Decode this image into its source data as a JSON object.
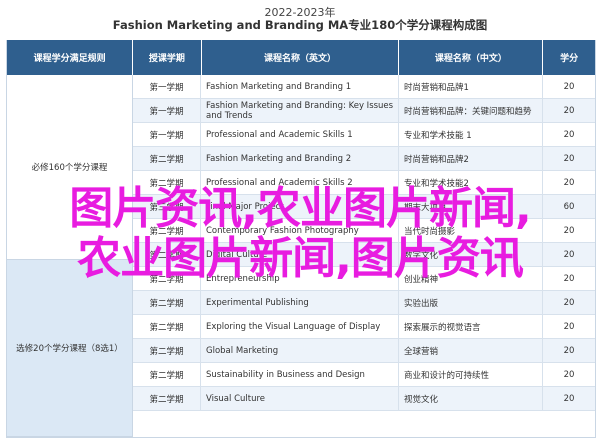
{
  "header": {
    "year": "2022-2023年",
    "title": "Fashion Marketing and Branding MA专业180个学分课程构成图"
  },
  "table": {
    "columns": [
      "课程学分满足规则",
      "授课学期",
      "课程名称（英文）",
      "课程名称（中文）",
      "学分"
    ],
    "groups": [
      "必修160个学分课程",
      "选修20个学分课程（8选1）"
    ],
    "rows": [
      {
        "term": "第一学期",
        "en": "Fashion Marketing and Branding 1",
        "zh": "时尚营销和品牌1",
        "credits": "20"
      },
      {
        "term": "第一学期",
        "en": "Fashion Marketing and Branding: Key Issues and Trends",
        "zh": "时尚营销和品牌：关键问题和趋势",
        "credits": "20"
      },
      {
        "term": "第一学期",
        "en": "Professional and Academic Skills 1",
        "zh": "专业和学术技能 1",
        "credits": "20"
      },
      {
        "term": "第二学期",
        "en": "Fashion Marketing and Branding 2",
        "zh": "时尚营销和品牌2",
        "credits": "20"
      },
      {
        "term": "第二学期",
        "en": "Professional and Academic Skills 2",
        "zh": "专业和学术技能2",
        "credits": "20"
      },
      {
        "term": "第三学期",
        "en": "Final Major Project",
        "zh": "期末大项目",
        "credits": "60"
      },
      {
        "term": "第二学期",
        "en": "Contemporary Fashion Photography",
        "zh": "当代时尚摄影",
        "credits": "20"
      },
      {
        "term": "第二学期",
        "en": "Digital Culture",
        "zh": "数字文化",
        "credits": "20"
      },
      {
        "term": "第二学期",
        "en": "Entrepreneurship",
        "zh": "创业精神",
        "credits": "20"
      },
      {
        "term": "第二学期",
        "en": "Experimental Publishing",
        "zh": "实验出版",
        "credits": "20"
      },
      {
        "term": "第二学期",
        "en": "Exploring the Visual Language of Display",
        "zh": "探索展示的视觉语言",
        "credits": "20"
      },
      {
        "term": "第二学期",
        "en": "Global Marketing",
        "zh": "全球营销",
        "credits": "20"
      },
      {
        "term": "第二学期",
        "en": "Sustainability in Business and Design",
        "zh": "商业和设计的可持续性",
        "credits": "20"
      },
      {
        "term": "第二学期",
        "en": "Visual Culture",
        "zh": "视觉文化",
        "credits": "20"
      }
    ]
  },
  "overlay": {
    "line1": "图片资讯,农业图片新闻,",
    "line2": "农业图片新闻,图片资讯"
  }
}
